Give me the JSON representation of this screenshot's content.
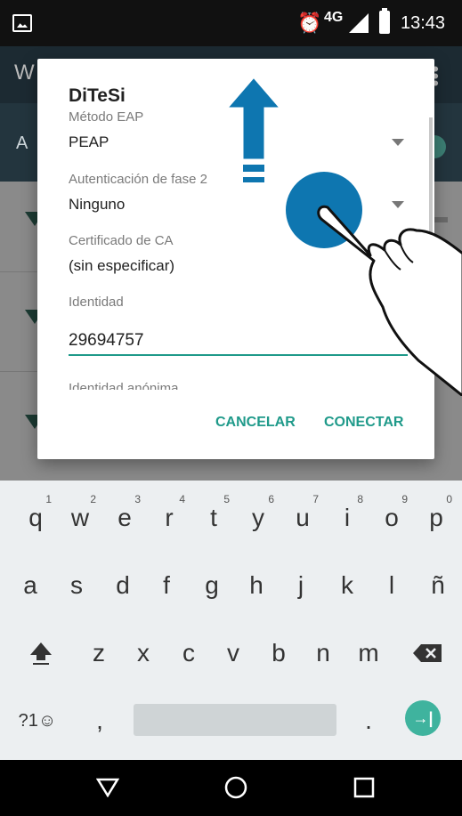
{
  "status_bar": {
    "network": "4G",
    "time": "13:43",
    "icons": [
      "gallery-icon",
      "alarm-icon",
      "signal-icon",
      "battery-icon"
    ]
  },
  "background_app": {
    "toolbar_initial": "W",
    "subbar_initial": "A"
  },
  "dialog": {
    "title": "DiTeSi",
    "eap_method_label": "Método EAP",
    "eap_method_value": "PEAP",
    "phase2_label": "Autenticación de fase 2",
    "phase2_value": "Ninguno",
    "ca_cert_label": "Certificado de CA",
    "ca_cert_value": "(sin especificar)",
    "identity_label": "Identidad",
    "identity_value": "29694757",
    "anonymous_identity_label": "Identidad anónima",
    "cancel_label": "CANCELAR",
    "connect_label": "CONECTAR",
    "accent_color": "#1f9a8a"
  },
  "overlay": {
    "arrow_color": "#0e76b0",
    "tap_circle_color": "#0e76b0",
    "icons": [
      "arrow-up-icon",
      "tap-circle-icon",
      "hand-pointer-icon"
    ]
  },
  "keyboard": {
    "row1": [
      {
        "char": "q",
        "hint": "1"
      },
      {
        "char": "w",
        "hint": "2"
      },
      {
        "char": "e",
        "hint": "3"
      },
      {
        "char": "r",
        "hint": "4"
      },
      {
        "char": "t",
        "hint": "5"
      },
      {
        "char": "y",
        "hint": "6"
      },
      {
        "char": "u",
        "hint": "7"
      },
      {
        "char": "i",
        "hint": "8"
      },
      {
        "char": "o",
        "hint": "9"
      },
      {
        "char": "p",
        "hint": "0"
      }
    ],
    "row2": [
      "a",
      "s",
      "d",
      "f",
      "g",
      "h",
      "j",
      "k",
      "l",
      "ñ"
    ],
    "row3": [
      "z",
      "x",
      "c",
      "v",
      "b",
      "n",
      "m"
    ],
    "symbols_label": "?1☺",
    "comma": ",",
    "period": ".",
    "enter_glyph": "→|",
    "enter_color": "#3fb39e"
  },
  "nav_bar": {
    "icons": [
      "back-icon",
      "home-icon",
      "recents-icon"
    ]
  }
}
